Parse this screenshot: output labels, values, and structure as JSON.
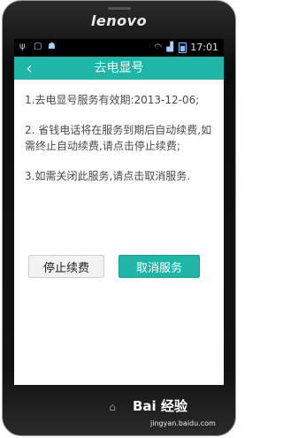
{
  "device": {
    "brand": "lenovo"
  },
  "statusbar": {
    "time": "17:01"
  },
  "titlebar": {
    "back_icon": "chevron-left-icon",
    "title": "去电显号"
  },
  "content": {
    "paragraphs": [
      "1.去电显号服务有效期:2013-12-06;",
      "2. 省钱电话将在服务到期后自动续费,如需终止自动续费,请点击停止续费;",
      "3.如需关闭此服务,请点击取消服务."
    ]
  },
  "buttons": {
    "stop_label": "停止续费",
    "cancel_label": "取消服务"
  },
  "watermark": {
    "text": "Bai 经验",
    "url": "jingyan.baidu.com"
  },
  "colors": {
    "accent": "#1fb6a8",
    "statusbar": "#000000",
    "text": "#4a4a4a"
  }
}
